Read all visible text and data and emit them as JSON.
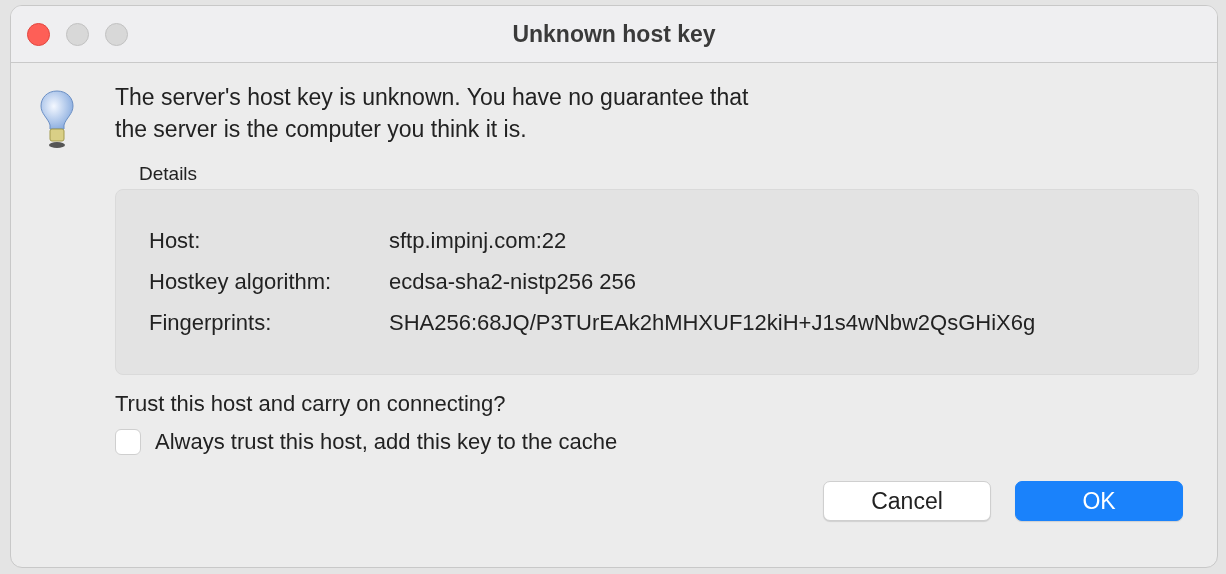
{
  "window": {
    "title": "Unknown host key"
  },
  "message": [
    "The server's host key is unknown. You have no guarantee that",
    "the server is the computer you think it is."
  ],
  "details": {
    "title": "Details",
    "rows": [
      {
        "label": "Host:",
        "value": "sftp.impinj.com:22"
      },
      {
        "label": "Hostkey algorithm:",
        "value": "ecdsa-sha2-nistp256 256"
      },
      {
        "label": "Fingerprints:",
        "value": "SHA256:68JQ/P3TUrEAk2hMHXUF12kiH+J1s4wNbw2QsGHiX6g"
      }
    ]
  },
  "question": "Trust this host and carry on connecting?",
  "always_trust": {
    "label": "Always trust this host, add this key to the cache",
    "checked": false
  },
  "buttons": [
    {
      "label": "Cancel",
      "default": false
    },
    {
      "label": "OK",
      "default": true
    }
  ]
}
